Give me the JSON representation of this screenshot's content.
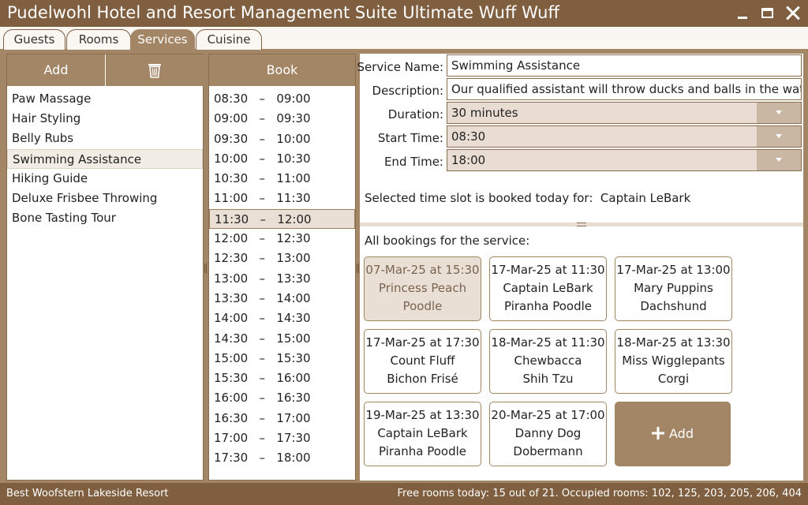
{
  "window": {
    "title": "Pudelwohl Hotel and Resort Management Suite Ultimate Wuff Wuff"
  },
  "tabs": [
    "Guests",
    "Rooms",
    "Services",
    "Cuisine"
  ],
  "active_tab": "Services",
  "services_panel": {
    "add_label": "Add",
    "delete_icon": "trash-icon",
    "items": [
      "Paw Massage",
      "Hair Styling",
      "Belly Rubs",
      "Swimming Assistance",
      "Hiking Guide",
      "Deluxe Frisbee Throwing",
      "Bone Tasting Tour"
    ],
    "selected": "Swimming Assistance"
  },
  "slots_panel": {
    "book_label": "Book",
    "slots": [
      "08:30   –   09:00",
      "09:00   –   09:30",
      "09:30   –   10:00",
      "10:00   –   10:30",
      "10:30   –   11:00",
      "11:00   –   11:30",
      "11:30   –   12:00",
      "12:00   –   12:30",
      "12:30   –   13:00",
      "13:00   –   13:30",
      "13:30   –   14:00",
      "14:00   –   14:30",
      "14:30   –   15:00",
      "15:00   –   15:30",
      "15:30   –   16:00",
      "16:00   –   16:30",
      "16:30   –   17:00",
      "17:00   –   17:30",
      "17:30   –   18:00"
    ],
    "selected": "11:30   –   12:00"
  },
  "details": {
    "service_name_label": "Service Name:",
    "service_name": "Swimming Assistance",
    "description_label": "Description:",
    "description": "Our qualified assistant will throw ducks and balls in the water",
    "duration_label": "Duration:",
    "duration": "30 minutes",
    "start_label": "Start Time:",
    "start": "08:30",
    "end_label": "End Time:",
    "end": "18:00",
    "booked_text": "Selected time slot is booked today for:  Captain LeBark",
    "all_bookings_label": "All bookings for the service:",
    "add_label": "Add",
    "add_icon": "plus-icon"
  },
  "bookings": [
    {
      "when": "07-Mar-25 at 15:30",
      "guest": "Princess Peach",
      "breed": "Poodle"
    },
    {
      "when": "17-Mar-25 at 11:30",
      "guest": "Captain LeBark",
      "breed": "Piranha Poodle"
    },
    {
      "when": "17-Mar-25 at 13:00",
      "guest": "Mary Puppins",
      "breed": "Dachshund"
    },
    {
      "when": "17-Mar-25 at 17:30",
      "guest": "Count Fluff",
      "breed": "Bichon Frisé"
    },
    {
      "when": "18-Mar-25 at 11:30",
      "guest": "Chewbacca",
      "breed": "Shih Tzu"
    },
    {
      "when": "18-Mar-25 at 13:30",
      "guest": "Miss Wigglepants",
      "breed": "Corgi"
    },
    {
      "when": "19-Mar-25 at 13:30",
      "guest": "Captain LeBark",
      "breed": "Piranha Poodle"
    },
    {
      "when": "20-Mar-25 at 17:00",
      "guest": "Danny Dog",
      "breed": "Dobermann"
    }
  ],
  "selected_booking": 0,
  "status": {
    "left": "Best Woofstern Lakeside Resort",
    "right": "Free rooms today: 15 out of 21.  Occupied rooms: 102, 125, 203, 205, 206, 404"
  },
  "colors": {
    "brand": "#7f5f40",
    "accent": "#a38665",
    "selection": "#eadfd4"
  }
}
